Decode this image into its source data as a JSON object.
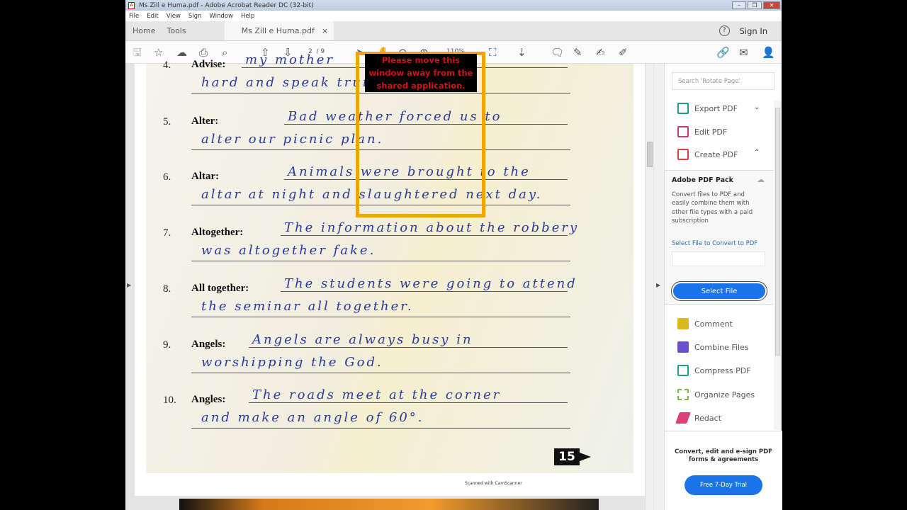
{
  "window": {
    "title": "Ms Zill e Huma.pdf - Adobe Acrobat Reader DC (32-bit)",
    "menu": [
      "File",
      "Edit",
      "View",
      "Sign",
      "Window",
      "Help"
    ]
  },
  "tabs": {
    "home": "Home",
    "tools": "Tools",
    "document": "Ms Zill e Huma.pdf",
    "close": "×",
    "sign_in": "Sign In",
    "help": "?"
  },
  "toolbar": {
    "page_current": "2",
    "page_total": "/ 9",
    "zoom": "110%"
  },
  "document": {
    "entries": [
      {
        "num": "4.",
        "word": "Advise:",
        "line1": "my mother",
        "line2": "hard and speak truth always."
      },
      {
        "num": "5.",
        "word": "Alter:",
        "line1": "Bad weather forced us to",
        "line2": "alter our picnic plan."
      },
      {
        "num": "6.",
        "word": "Altar:",
        "line1": "Animals were brought to the",
        "line2": "altar at night and slaughtered next day."
      },
      {
        "num": "7.",
        "word": "Altogether:",
        "line1": "The information about the robbery",
        "line2": "was altogether fake."
      },
      {
        "num": "8.",
        "word": "All together:",
        "line1": "The students were going to attend",
        "line2": "the seminar all together."
      },
      {
        "num": "9.",
        "word": "Angels:",
        "line1": "Angels are always busy in",
        "line2": "worshipping the God."
      },
      {
        "num": "10.",
        "word": "Angles:",
        "line1": "The roads meet at the corner",
        "line2": "and make an angle of 60°."
      }
    ],
    "page_badge": "15",
    "footer": "Scanned with CamScanner"
  },
  "right_panel": {
    "search_placeholder": "Search 'Rotate Page'",
    "tools_top": [
      {
        "label": "Export PDF",
        "color": "#1f9c8a"
      },
      {
        "label": "Edit PDF",
        "color": "#c0407a"
      },
      {
        "label": "Create PDF",
        "color": "#d9404a"
      }
    ],
    "pack": {
      "title": "Adobe PDF Pack",
      "desc": "Convert files to PDF and easily combine them with other file types with a paid subscription",
      "select_label": "Select File to Convert to PDF",
      "button": "Select File"
    },
    "tools_bottom": [
      {
        "label": "Comment",
        "color": "#d9b820"
      },
      {
        "label": "Combine Files",
        "color": "#6a4fcf"
      },
      {
        "label": "Compress PDF",
        "color": "#1f9c8a"
      },
      {
        "label": "Organize Pages",
        "color": "#7ab648"
      },
      {
        "label": "Redact",
        "color": "#d9407a"
      }
    ],
    "promo": {
      "text": "Convert, edit and e-sign PDF forms & agreements",
      "button": "Free 7-Day Trial"
    }
  },
  "overlay": {
    "warning": "Please move this window away from the shared application."
  }
}
